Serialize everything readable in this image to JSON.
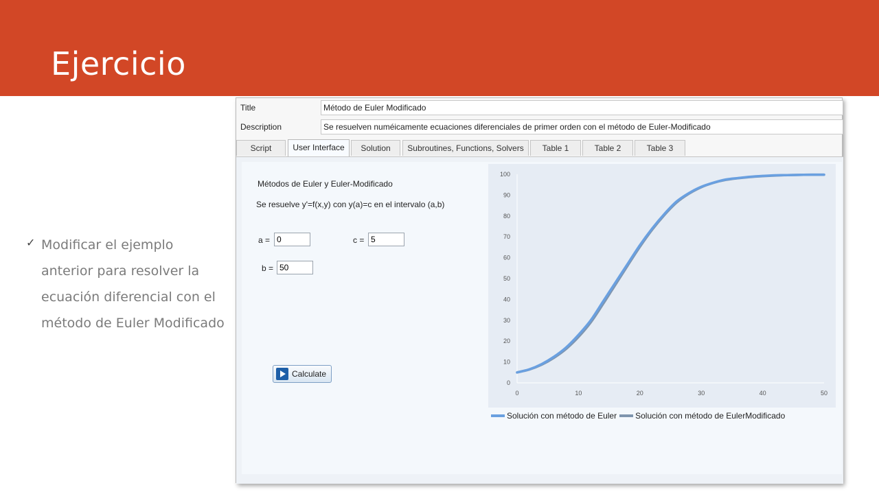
{
  "slide": {
    "title": "Ejercicio",
    "bullet": "Modificar el ejemplo anterior para resolver la ecuación diferencial con el método de Euler Modificado"
  },
  "app": {
    "title_label": "Title",
    "title_value": "Método de Euler Modificado",
    "description_label": "Description",
    "description_value": "Se resuelven numéicamente ecuaciones diferenciales de primer orden con el método de Euler-Modificado",
    "tabs": [
      {
        "label": "Script"
      },
      {
        "label": "User Interface"
      },
      {
        "label": "Solution"
      },
      {
        "label": "Subroutines, Functions, Solvers"
      },
      {
        "label": "Table 1"
      },
      {
        "label": "Table 2"
      },
      {
        "label": "Table 3"
      }
    ],
    "active_tab": "User Interface",
    "ui": {
      "heading": "Métodos de Euler y Euler-Modificado",
      "description": "Se resuelve y'=f(x,y) con y(a)=c en el intervalo (a,b)",
      "a_label": "a =",
      "a_value": "0",
      "c_label": "c =",
      "c_value": "5",
      "b_label": "b =",
      "b_value": "50",
      "calculate_label": "Calculate"
    }
  },
  "colors": {
    "banner": "#d24726",
    "euler": "#6aa0e0",
    "euler_mod": "#7f95ae"
  },
  "chart_data": {
    "type": "line",
    "title": "",
    "xlabel": "",
    "ylabel": "",
    "xlim": [
      0,
      50
    ],
    "ylim": [
      0,
      100
    ],
    "xticks": [
      0,
      10,
      20,
      30,
      40,
      50
    ],
    "yticks": [
      0,
      10,
      20,
      30,
      40,
      50,
      60,
      70,
      80,
      90,
      100
    ],
    "grid": false,
    "legend": "bottom",
    "x": [
      0,
      2,
      4,
      6,
      8,
      10,
      12,
      14,
      16,
      18,
      20,
      22,
      24,
      26,
      28,
      30,
      32,
      34,
      36,
      38,
      40,
      42,
      44,
      46,
      48,
      50
    ],
    "series": [
      {
        "name": "Solución con método de Euler",
        "values": [
          5,
          6.5,
          9,
          12.5,
          17,
          23,
          30,
          39,
          48,
          57,
          66,
          74,
          81,
          87,
          91,
          94,
          96,
          97.5,
          98.2,
          98.8,
          99.2,
          99.5,
          99.6,
          99.7,
          99.8,
          99.8
        ]
      },
      {
        "name": "Solución con método de EulerModificado",
        "values": [
          5,
          6.4,
          8.7,
          12,
          16.3,
          22,
          29,
          37.8,
          47,
          56.2,
          65.2,
          73.4,
          80.5,
          86.5,
          90.7,
          93.8,
          95.9,
          97.3,
          98.1,
          98.7,
          99.1,
          99.4,
          99.6,
          99.7,
          99.8,
          99.8
        ]
      }
    ]
  }
}
